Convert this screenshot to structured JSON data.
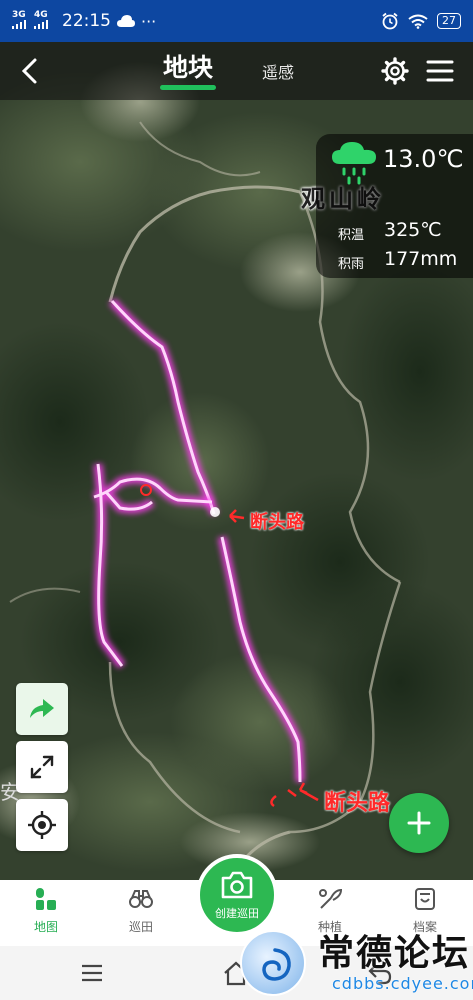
{
  "status_bar": {
    "signal_1": "3G",
    "signal_2": "4G",
    "time": "22:15",
    "more": "···",
    "battery": "27"
  },
  "header": {
    "tab_active": "地块",
    "tab_inactive": "遥感"
  },
  "weather": {
    "temperature": "13.0℃",
    "accum_temp_label": "积温",
    "accum_temp_value": "325℃",
    "accum_rain_label": "积雨",
    "accum_rain_value": "177mm"
  },
  "map": {
    "place_name": "观山岭",
    "annotation_1": "断头路",
    "annotation_2": "断头路",
    "route_color": "#ff3ef0",
    "annotation_color": "#ff2a2a"
  },
  "bottom_nav": {
    "items": [
      {
        "label": "地图"
      },
      {
        "label": "巡田"
      },
      {
        "label": "创建巡田"
      },
      {
        "label": "种植"
      },
      {
        "label": "档案"
      }
    ],
    "accent": "#2db852"
  },
  "watermark": {
    "brand": "常德论坛",
    "url": "cdbbs.cdyee.com"
  }
}
